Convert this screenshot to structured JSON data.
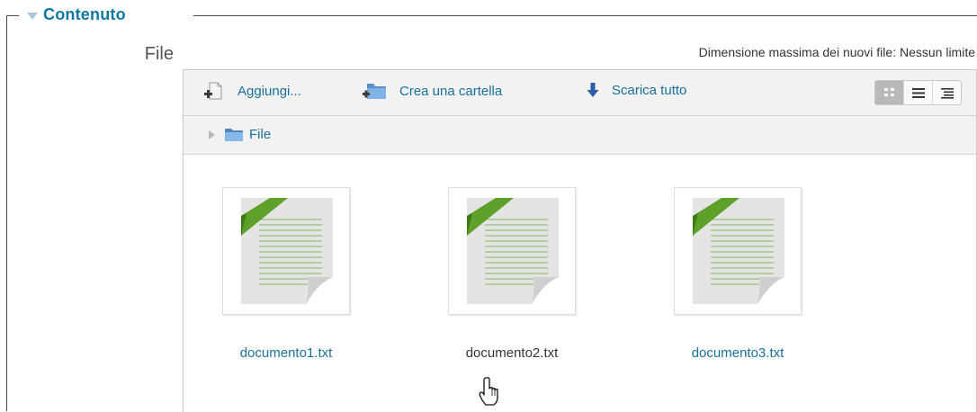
{
  "fieldset": {
    "legend": "Contenuto"
  },
  "field": {
    "label": "File",
    "max_size_text": "Dimensione massima dei nuovi file: Nessun limite"
  },
  "toolbar": {
    "add_label": "Aggiungi...",
    "create_folder_label": "Crea una cartella",
    "download_all_label": "Scarica tutto",
    "views": [
      "view-icons",
      "view-list",
      "view-tree"
    ],
    "active_view": "view-icons"
  },
  "path": {
    "current": "File"
  },
  "files": [
    {
      "name": "documento1.txt",
      "icon": "text-document-icon"
    },
    {
      "name": "documento2.txt",
      "icon": "text-document-icon"
    },
    {
      "name": "documento3.txt",
      "icon": "text-document-icon"
    }
  ],
  "colors": {
    "accent": "#1177a5",
    "link": "#1a6f9c",
    "toolbar_bg": "#f2f2f2",
    "corner_ribbon": "#5fa02a"
  }
}
